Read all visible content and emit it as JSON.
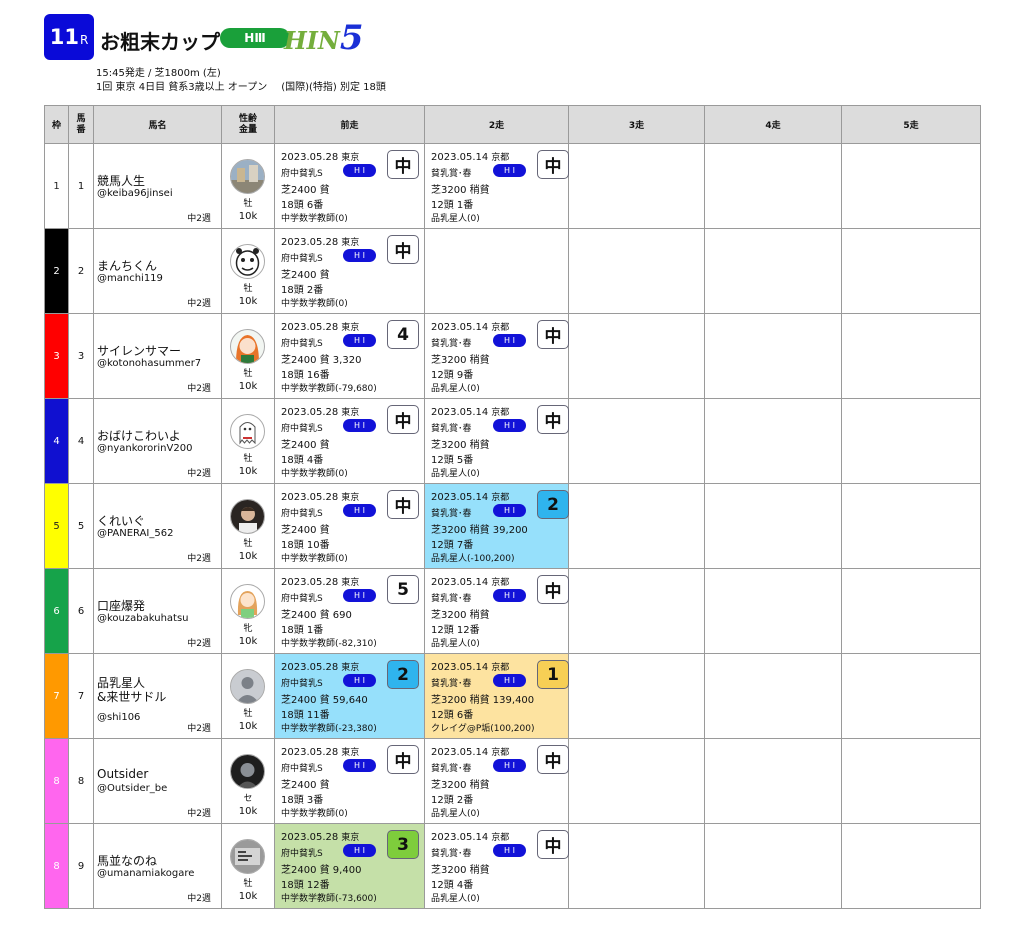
{
  "header": {
    "race_number": "11",
    "race_suffix": "R",
    "race_name": "お粗末カップ",
    "grade": "HⅢ",
    "logo_text": "HIN",
    "logo_num": "5",
    "meta_line1": "15:45発走 / 芝1800m (左)",
    "meta_line2a": "1回 東京 4日目 貧系3歳以上 オープン",
    "meta_line2b": "(国際)(特指) 別定 18頭"
  },
  "columns": {
    "waku": "枠",
    "uma": "馬番",
    "name": "馬名",
    "sex_prize": "性齢金量",
    "prev1": "前走",
    "prev2": "2走",
    "prev3": "3走",
    "prev4": "4走",
    "prev5": "5走"
  },
  "colors": {
    "race_badge": "#0a0ad8",
    "grade_pill": "#1aa03a",
    "grade_pill_run": "#1212d8",
    "waku": [
      "#ffffff",
      "#000000",
      "#ff0000",
      "#1010d0",
      "#ffff00",
      "#16a34a",
      "#ff9900",
      "#ff66ee",
      "#ff66ee"
    ]
  },
  "horses": [
    {
      "waku": "1",
      "uma": "1",
      "name": "競馬人生",
      "handle": "@keiba96jinsei",
      "weeks": "中2週",
      "sex": "牡",
      "prize": "10k",
      "avatar_icon": "street-photo-icon",
      "runs": [
        {
          "date": "2023.05.28",
          "venue": "東京",
          "race": "府中貧乳S",
          "grade": "H I",
          "cond": "芝2400 貧",
          "field": "18頭 6番",
          "bet": "中学数学教師(0)",
          "pos": "中"
        },
        {
          "date": "2023.05.14",
          "venue": "京都",
          "race": "貧乳賞･春",
          "grade": "H I",
          "cond": "芝3200 稍貧",
          "field": "12頭 1番",
          "bet": "品乳星人(0)",
          "pos": "中"
        }
      ]
    },
    {
      "waku": "2",
      "uma": "2",
      "name": "まんちくん",
      "handle": "@manchi119",
      "weeks": "中2週",
      "sex": "牡",
      "prize": "10k",
      "avatar_icon": "cartoon-face-icon",
      "runs": [
        {
          "date": "2023.05.28",
          "venue": "東京",
          "race": "府中貧乳S",
          "grade": "H I",
          "cond": "芝2400 貧",
          "field": "18頭 2番",
          "bet": "中学数学教師(0)",
          "pos": "中"
        }
      ]
    },
    {
      "waku": "3",
      "uma": "3",
      "name": "サイレンサマー",
      "handle": "@kotonohasummer7",
      "weeks": "中2週",
      "sex": "牡",
      "prize": "10k",
      "avatar_icon": "anime-girl-icon",
      "runs": [
        {
          "date": "2023.05.28",
          "venue": "東京",
          "race": "府中貧乳S",
          "grade": "H I",
          "cond": "芝2400 貧 3,320",
          "field": "18頭 16番",
          "bet": "中学数学教師(-79,680)",
          "pos": "4"
        },
        {
          "date": "2023.05.14",
          "venue": "京都",
          "race": "貧乳賞･春",
          "grade": "H I",
          "cond": "芝3200 稍貧",
          "field": "12頭 9番",
          "bet": "品乳星人(0)",
          "pos": "中"
        }
      ]
    },
    {
      "waku": "4",
      "uma": "4",
      "name": "おばけこわいよ",
      "handle": "@nyankororinV200",
      "weeks": "中2週",
      "sex": "牡",
      "prize": "10k",
      "avatar_icon": "ghost-icon",
      "runs": [
        {
          "date": "2023.05.28",
          "venue": "東京",
          "race": "府中貧乳S",
          "grade": "H I",
          "cond": "芝2400 貧",
          "field": "18頭 4番",
          "bet": "中学数学教師(0)",
          "pos": "中"
        },
        {
          "date": "2023.05.14",
          "venue": "京都",
          "race": "貧乳賞･春",
          "grade": "H I",
          "cond": "芝3200 稍貧",
          "field": "12頭 5番",
          "bet": "品乳星人(0)",
          "pos": "中"
        }
      ]
    },
    {
      "waku": "5",
      "uma": "5",
      "name": "くれいぐ",
      "handle": "@PANERAI_562",
      "weeks": "中2週",
      "sex": "牡",
      "prize": "10k",
      "avatar_icon": "man-portrait-icon",
      "runs": [
        {
          "date": "2023.05.28",
          "venue": "東京",
          "race": "府中貧乳S",
          "grade": "H I",
          "cond": "芝2400 貧",
          "field": "18頭 10番",
          "bet": "中学数学教師(0)",
          "pos": "中"
        },
        {
          "date": "2023.05.14",
          "venue": "京都",
          "race": "貧乳賞･春",
          "grade": "H I",
          "cond": "芝3200 稍貧 39,200",
          "field": "12頭 7番",
          "bet": "品乳星人(-100,200)",
          "pos": "2",
          "hl": "blue"
        }
      ]
    },
    {
      "waku": "6",
      "uma": "6",
      "name": "口座爆発",
      "handle": "@kouzabakuhatsu",
      "weeks": "中2週",
      "sex": "牝",
      "prize": "10k",
      "avatar_icon": "girl-illustration-icon",
      "runs": [
        {
          "date": "2023.05.28",
          "venue": "東京",
          "race": "府中貧乳S",
          "grade": "H I",
          "cond": "芝2400 貧 690",
          "field": "18頭 1番",
          "bet": "中学数学教師(-82,310)",
          "pos": "5"
        },
        {
          "date": "2023.05.14",
          "venue": "京都",
          "race": "貧乳賞･春",
          "grade": "H I",
          "cond": "芝3200 稍貧",
          "field": "12頭 12番",
          "bet": "品乳星人(0)",
          "pos": "中"
        }
      ]
    },
    {
      "waku": "7",
      "uma": "7",
      "name": "品乳星人",
      "name2": "&来世サドル",
      "handle": "@shi106",
      "weeks": "中2週",
      "sex": "牡",
      "prize": "10k",
      "avatar_icon": "default-user-icon",
      "runs": [
        {
          "date": "2023.05.28",
          "venue": "東京",
          "race": "府中貧乳S",
          "grade": "H I",
          "cond": "芝2400 貧 59,640",
          "field": "18頭 11番",
          "bet": "中学数学教師(-23,380)",
          "pos": "2",
          "hl": "blue"
        },
        {
          "date": "2023.05.14",
          "venue": "京都",
          "race": "貧乳賞･春",
          "grade": "H I",
          "cond": "芝3200 稍貧 139,400",
          "field": "12頭 6番",
          "bet": "クレイグ@P垢(100,200)",
          "pos": "1",
          "hl": "orange"
        }
      ]
    },
    {
      "waku": "8",
      "uma": "8",
      "name": "Outsider",
      "handle": "@Outsider_be",
      "weeks": "中2週",
      "sex": "セ",
      "prize": "10k",
      "avatar_icon": "dark-portrait-icon",
      "runs": [
        {
          "date": "2023.05.28",
          "venue": "東京",
          "race": "府中貧乳S",
          "grade": "H I",
          "cond": "芝2400 貧",
          "field": "18頭 3番",
          "bet": "中学数学教師(0)",
          "pos": "中"
        },
        {
          "date": "2023.05.14",
          "venue": "京都",
          "race": "貧乳賞･春",
          "grade": "H I",
          "cond": "芝3200 稍貧",
          "field": "12頭 2番",
          "bet": "品乳星人(0)",
          "pos": "中"
        }
      ]
    },
    {
      "waku": "8",
      "uma": "9",
      "name": "馬並なのね",
      "handle": "@umanamiakogare",
      "weeks": "中2週",
      "sex": "牡",
      "prize": "10k",
      "avatar_icon": "grey-photo-icon",
      "runs": [
        {
          "date": "2023.05.28",
          "venue": "東京",
          "race": "府中貧乳S",
          "grade": "H I",
          "cond": "芝2400 貧 9,400",
          "field": "18頭 12番",
          "bet": "中学数学教師(-73,600)",
          "pos": "3",
          "hl": "green"
        },
        {
          "date": "2023.05.14",
          "venue": "京都",
          "race": "貧乳賞･春",
          "grade": "H I",
          "cond": "芝3200 稍貧",
          "field": "12頭 4番",
          "bet": "品乳星人(0)",
          "pos": "中"
        }
      ]
    }
  ]
}
